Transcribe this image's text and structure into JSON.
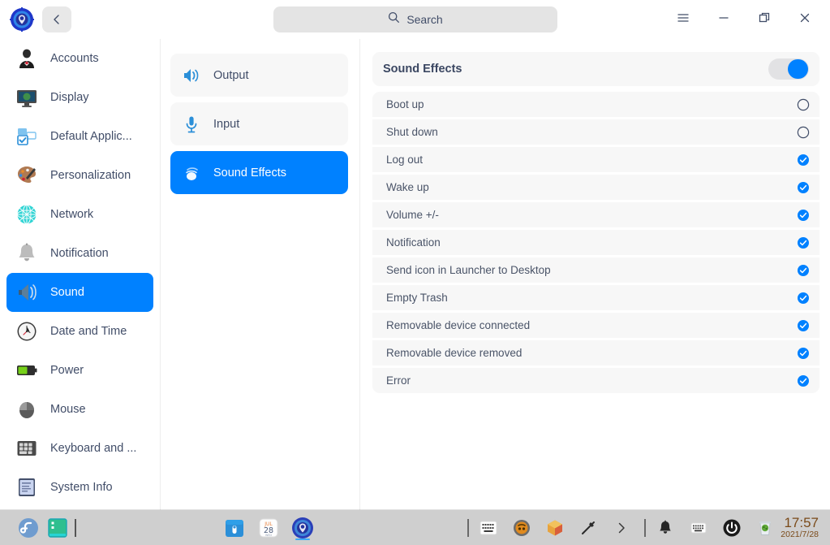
{
  "window": {
    "app_logo_icon": "deepin-settings-logo-icon",
    "back_button_icon": "chevron-left-icon",
    "search": {
      "placeholder": "Search",
      "icon": "search-icon"
    },
    "controls": {
      "menu_label": "menu-icon",
      "minimize_label": "minimize-icon",
      "maximize_label": "restore-icon",
      "close_label": "close-icon"
    }
  },
  "sidebar": {
    "items": [
      {
        "label": "Accounts",
        "icon": "accounts-icon",
        "active": false
      },
      {
        "label": "Display",
        "icon": "display-icon",
        "active": false
      },
      {
        "label": "Default Applic...",
        "icon": "default-apps-icon",
        "active": false
      },
      {
        "label": "Personalization",
        "icon": "personalization-icon",
        "active": false
      },
      {
        "label": "Network",
        "icon": "network-icon",
        "active": false
      },
      {
        "label": "Notification",
        "icon": "notification-icon",
        "active": false
      },
      {
        "label": "Sound",
        "icon": "sound-icon",
        "active": true
      },
      {
        "label": "Date and Time",
        "icon": "clock-icon",
        "active": false
      },
      {
        "label": "Power",
        "icon": "battery-icon",
        "active": false
      },
      {
        "label": "Mouse",
        "icon": "mouse-icon",
        "active": false
      },
      {
        "label": "Keyboard and ...",
        "icon": "keyboard-icon",
        "active": false
      },
      {
        "label": "System Info",
        "icon": "system-info-icon",
        "active": false
      }
    ]
  },
  "categories": {
    "items": [
      {
        "label": "Output",
        "icon": "speaker-icon",
        "active": false
      },
      {
        "label": "Input",
        "icon": "microphone-icon",
        "active": false
      },
      {
        "label": "Sound Effects",
        "icon": "sound-effects-icon",
        "active": true
      }
    ]
  },
  "panel": {
    "title": "Sound Effects",
    "toggle_state": "on",
    "effects": [
      {
        "label": "Boot up",
        "checked": false
      },
      {
        "label": "Shut down",
        "checked": false
      },
      {
        "label": "Log out",
        "checked": true
      },
      {
        "label": "Wake up",
        "checked": true
      },
      {
        "label": "Volume +/-",
        "checked": true
      },
      {
        "label": "Notification",
        "checked": true
      },
      {
        "label": "Send icon in Launcher to Desktop",
        "checked": true
      },
      {
        "label": "Empty Trash",
        "checked": true
      },
      {
        "label": "Removable device connected",
        "checked": true
      },
      {
        "label": "Removable device removed",
        "checked": true
      },
      {
        "label": "Error",
        "checked": true
      }
    ]
  },
  "taskbar": {
    "launchers": [
      {
        "name": "fedora-logo-icon"
      },
      {
        "name": "terminal-icon"
      }
    ],
    "center": [
      {
        "name": "file-manager-icon"
      },
      {
        "name": "calendar-icon",
        "month": "JUL",
        "day": "28"
      },
      {
        "name": "settings-icon",
        "active": true
      }
    ],
    "tray": [
      {
        "name": "keyboard-layout-icon"
      },
      {
        "name": "onboard-icon"
      },
      {
        "name": "package-icon"
      },
      {
        "name": "pen-icon"
      },
      {
        "name": "expand-tray-icon"
      }
    ],
    "status": [
      {
        "name": "notification-bell-icon"
      },
      {
        "name": "keyboard-tray-icon"
      },
      {
        "name": "power-icon"
      },
      {
        "name": "trash-icon"
      }
    ],
    "clock": {
      "time": "17:57",
      "date": "2021/7/28"
    }
  },
  "colors": {
    "accent": "#0081ff",
    "row_bg": "#f7f7f7",
    "text": "#414d68",
    "taskbar_bg": "#cfcfcf",
    "clock_text": "#7a4a19"
  }
}
